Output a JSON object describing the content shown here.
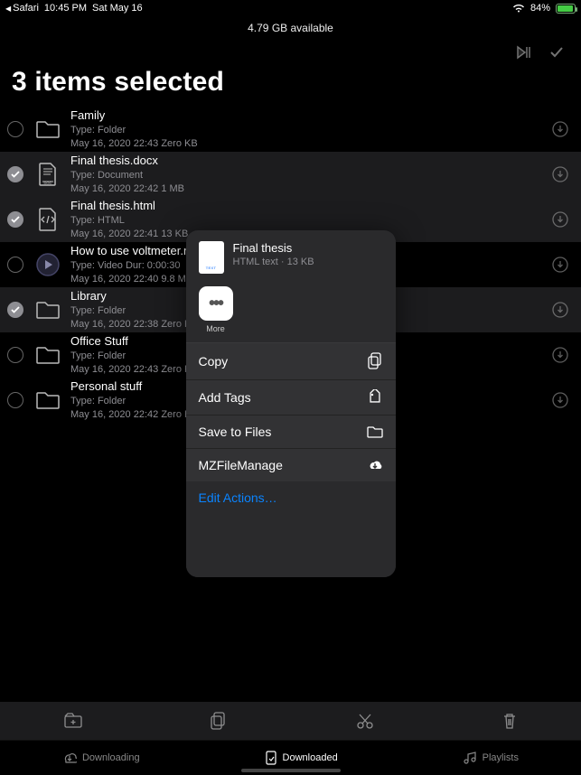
{
  "status": {
    "back": "Safari",
    "time": "10:45 PM",
    "date": "Sat May 16",
    "battery_pct": "84%"
  },
  "storage": "4.79 GB available",
  "title": "3 items selected",
  "files": [
    {
      "name": "Family",
      "type": "Type: Folder",
      "date": "May 16, 2020 22:43",
      "size": "Zero KB",
      "icon": "folder",
      "sel": false
    },
    {
      "name": "Final thesis.docx",
      "type": "Type: Document",
      "date": "May 16, 2020 22:42",
      "size": "1 MB",
      "icon": "doc",
      "sel": true
    },
    {
      "name": "Final thesis.html",
      "type": "Type: HTML",
      "date": "May 16, 2020 22:41",
      "size": "13 KB",
      "icon": "html",
      "sel": true
    },
    {
      "name": "How to use voltmeter.mp4",
      "type": "Type: Video",
      "dur": "Dur: 0:00:30",
      "date": "May 16, 2020 22:40",
      "size": "9.8 MB",
      "icon": "video",
      "sel": false
    },
    {
      "name": "Library",
      "type": "Type: Folder",
      "date": "May 16, 2020 22:38",
      "size": "Zero KB",
      "icon": "folder",
      "sel": true
    },
    {
      "name": "Office Stuff",
      "type": "Type: Folder",
      "date": "May 16, 2020 22:43",
      "size": "Zero KB",
      "icon": "folder",
      "sel": false
    },
    {
      "name": "Personal stuff",
      "type": "Type: Folder",
      "date": "May 16, 2020 22:42",
      "size": "Zero KB",
      "icon": "folder",
      "sel": false
    }
  ],
  "sheet": {
    "file_title": "Final thesis",
    "file_sub": "HTML text · 13 KB",
    "more_label": "More",
    "actions": {
      "copy": "Copy",
      "tags": "Add Tags",
      "save": "Save to Files",
      "app": "MZFileManage",
      "edit": "Edit Actions…"
    }
  },
  "tabs": {
    "downloading": "Downloading",
    "downloaded": "Downloaded",
    "playlists": "Playlists"
  }
}
